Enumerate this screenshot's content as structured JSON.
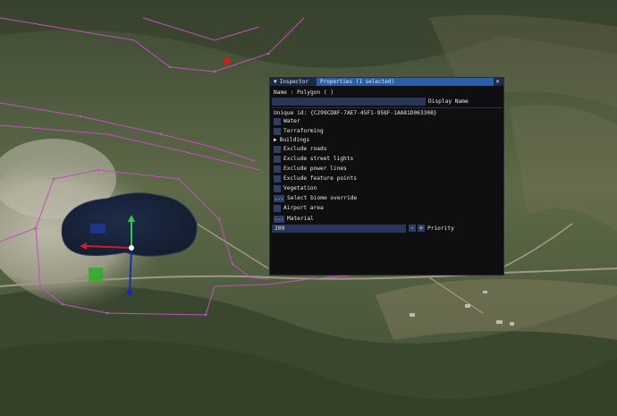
{
  "inspector": {
    "tabs": [
      {
        "label": "Inspector"
      },
      {
        "label": "Properties (1 selected)"
      }
    ],
    "close_glyph": "✕",
    "name_label": "Name : Polygon  ( )",
    "display_name_label": "Display Name",
    "display_name_value": "",
    "unique_id": "Unique id: {C299CD8F-7AE7-45F1-958F-1AA81D063308}",
    "items": [
      {
        "label": "Water"
      },
      {
        "label": "Terraforming"
      },
      {
        "label": "Buildings"
      },
      {
        "label": "Exclude roads"
      },
      {
        "label": "Exclude street lights"
      },
      {
        "label": "Exclude power lines"
      },
      {
        "label": "Exclude feature points"
      },
      {
        "label": "Vegetation"
      },
      {
        "label": "Select biome override"
      },
      {
        "label": "Airport area"
      },
      {
        "label": "Material"
      }
    ],
    "ellipsis": "...",
    "priority_value": "200",
    "priority_label": "Priority",
    "minus": "-",
    "plus": "+"
  },
  "colors": {
    "panel_bg": "#0f0f12",
    "active_tab": "#2a5ea8",
    "checkbox": "#2f3e63",
    "water": "#1b2840"
  },
  "icons": [
    "collapse-triangle-icon",
    "close-icon",
    "expand-arrow-icon",
    "move-gizmo-icon",
    "polygon-vertex-icon"
  ]
}
